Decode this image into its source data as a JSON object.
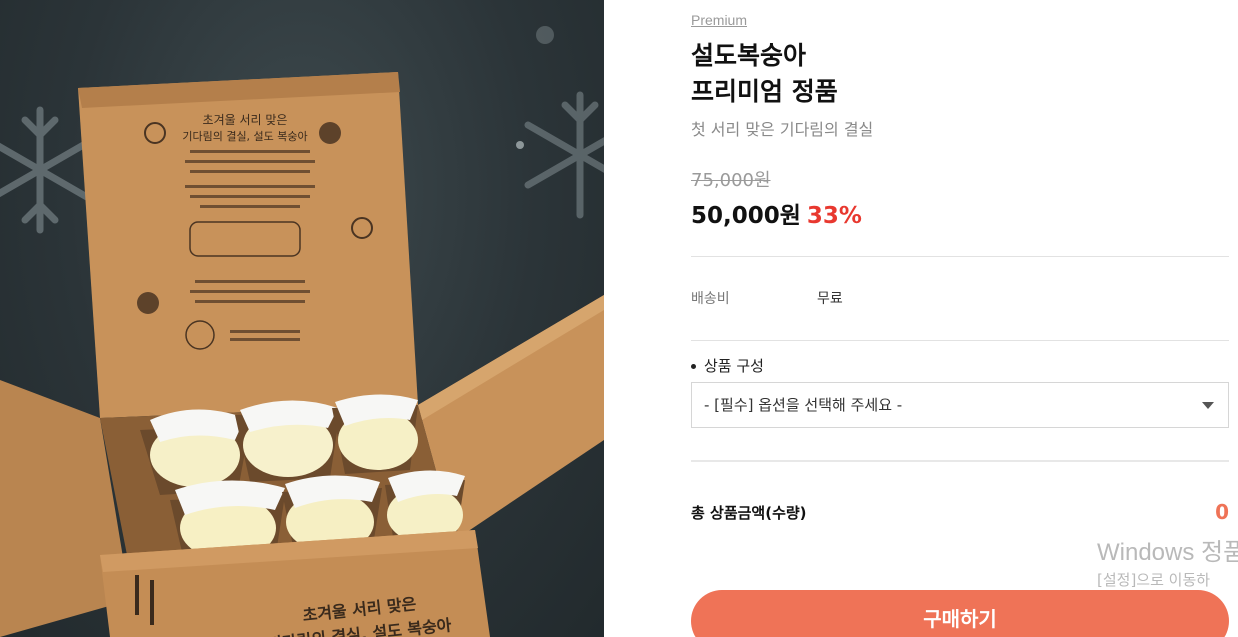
{
  "product": {
    "badge": "Premium",
    "title_line1": "설도복숭아",
    "title_line2": "프리미엄 정품",
    "subtitle": "첫 서리 맞은 기다림의 결실",
    "original_price": "75,000원",
    "sale_price": "50,000원",
    "discount": "33%"
  },
  "shipping": {
    "label": "배송비",
    "value": "무료"
  },
  "options": {
    "label": "상품 구성",
    "selected": "- [필수] 옵션을 선택해 주세요 -"
  },
  "total": {
    "label": "총 상품금액(수량)",
    "value": "0"
  },
  "buy_button": "구매하기",
  "watermark": {
    "line1": "Windows 정품",
    "line2": "[설정]으로 이동하"
  },
  "image": {
    "box_text_line1": "초겨울 서리 맞은",
    "box_text_line2": "기다림의 결실, 설도 복숭아",
    "front_text_line1": "초겨울 서리 맞은",
    "front_text_line2": "기다림의 결실, 설도 복숭아"
  },
  "colors": {
    "accent": "#ef7357",
    "discount": "#e8382f",
    "background_dark": "#2b3438",
    "box": "#c8925a"
  }
}
